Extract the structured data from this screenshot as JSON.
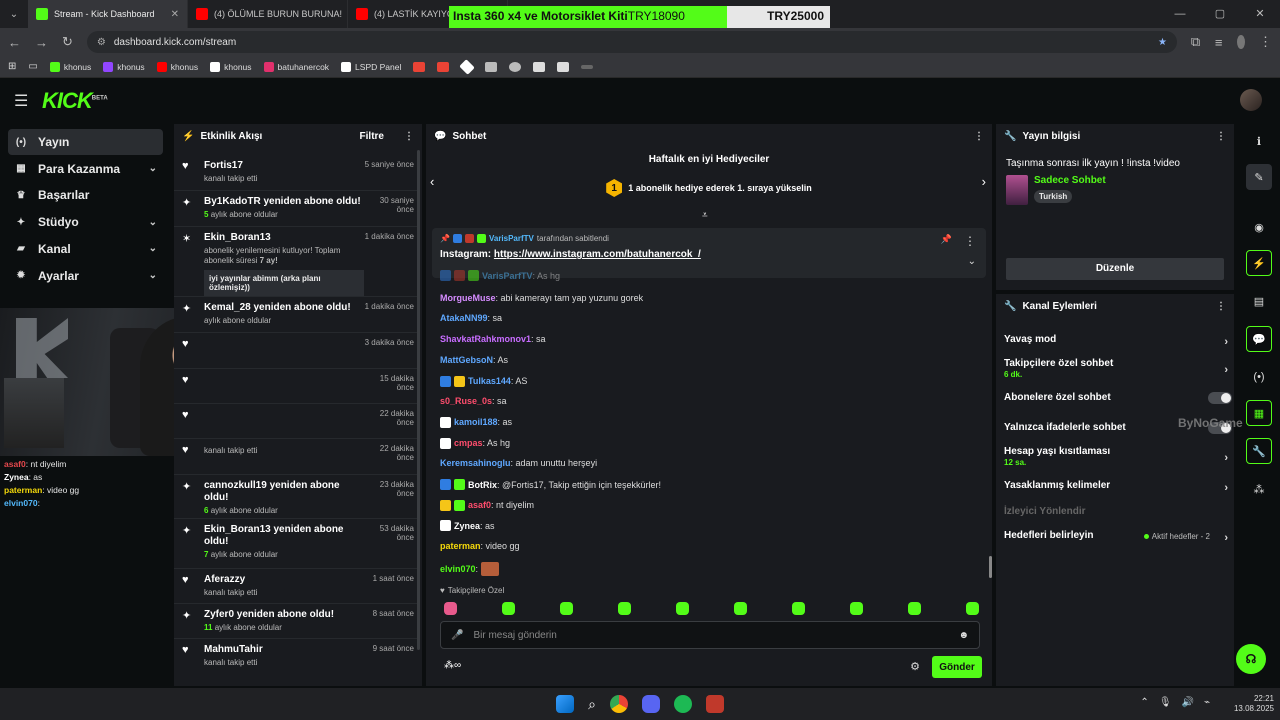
{
  "browser": {
    "tabs": [
      {
        "label": "Stream - Kick Dashboard",
        "active": true,
        "color": "#53fc18"
      },
      {
        "label": "(4) ÖLÜMLE BURUN BURUNA!",
        "active": false,
        "color": "#ff0000"
      },
      {
        "label": "(4) LASTİK KAYIYOR MU",
        "active": false,
        "color": "#ff0000"
      }
    ],
    "url": "dashboard.kick.com/stream",
    "bookmarks": [
      {
        "label": "khonus",
        "color": "#53fc18"
      },
      {
        "label": "khonus",
        "color": "#9146ff"
      },
      {
        "label": "khonus",
        "color": "#ff0000"
      },
      {
        "label": "khonus",
        "color": "#ffffff"
      },
      {
        "label": "batuhanercok",
        "color": "#e1306c"
      },
      {
        "label": "LSPD Panel",
        "color": "#ffffff"
      }
    ]
  },
  "donation": {
    "item": "Insta 360 x4 ve Motorsiklet Kiti",
    "current": "TRY18090",
    "goal": "TRY25000"
  },
  "header": {
    "logo": "KICK",
    "beta": "BETA"
  },
  "sidebar": {
    "items": [
      {
        "label": "Yayın",
        "icon": "broadcast-icon",
        "glyph": "(•)",
        "active": true,
        "chevron": false
      },
      {
        "label": "Para Kazanma",
        "icon": "money-icon",
        "glyph": "▦",
        "active": false,
        "chevron": true
      },
      {
        "label": "Başarılar",
        "icon": "trophy-icon",
        "glyph": "♛",
        "active": false,
        "chevron": false
      },
      {
        "label": "Stüdyo",
        "icon": "studio-icon",
        "glyph": "✦",
        "active": false,
        "chevron": true
      },
      {
        "label": "Kanal",
        "icon": "channel-icon",
        "glyph": "▰",
        "active": false,
        "chevron": true
      },
      {
        "label": "Ayarlar",
        "icon": "settings-icon",
        "glyph": "✹",
        "active": false,
        "chevron": true
      }
    ]
  },
  "overlay_chat": [
    {
      "user": "asaf0",
      "text": ": nt diyelim",
      "color": "#e5484d"
    },
    {
      "user": "Zynea",
      "text": ": as",
      "color": "#ffffff"
    },
    {
      "user": "paterman",
      "text": ": video gg",
      "color": "#f5d90a"
    },
    {
      "user": "elvin070",
      "text": ":",
      "color": "#53b9fc"
    }
  ],
  "activity": {
    "title": "Etkinlik Akışı",
    "filter": "Filtre",
    "items": [
      {
        "icon": "heart-icon",
        "glyph": "♥",
        "title": "Fortis17",
        "sub": "kanalı takip etti",
        "time": "5 saniye önce"
      },
      {
        "icon": "sparkle-icon",
        "glyph": "✦",
        "title": "By1KadoTR yeniden abone oldu!",
        "count": "5",
        "sub": "aylık abone oldular",
        "time": "30 saniye önce"
      },
      {
        "icon": "star-icon",
        "glyph": "✶",
        "title": "Ekin_Boran13",
        "sub": "abonelik yenilemesini kutluyor! Toplam abonelik süresi",
        "months": "7 ay!",
        "quote": "iyi yayınlar abimm (arka planı özlemişiz))",
        "time": "1 dakika önce"
      },
      {
        "icon": "sparkle-icon",
        "glyph": "✦",
        "title": "Kemal_28 yeniden abone oldu!",
        "sub": "aylık abone oldular",
        "time": "1 dakika önce"
      },
      {
        "icon": "heart-icon",
        "glyph": "♥",
        "title": "",
        "sub": "",
        "time": "3 dakika önce"
      },
      {
        "icon": "heart-icon",
        "glyph": "♥",
        "title": "",
        "sub": "",
        "time": "15 dakika önce"
      },
      {
        "icon": "heart-icon",
        "glyph": "♥",
        "title": "",
        "sub": "",
        "time": "22 dakika önce"
      },
      {
        "icon": "heart-icon",
        "glyph": "♥",
        "title": "",
        "sub": "kanalı takip etti",
        "time": "22 dakika önce"
      },
      {
        "icon": "sparkle-icon",
        "glyph": "✦",
        "title": "cannozkull19 yeniden abone oldu!",
        "count": "6",
        "sub": "aylık abone oldular",
        "time": "23 dakika önce"
      },
      {
        "icon": "sparkle-icon",
        "glyph": "✦",
        "title": "Ekin_Boran13 yeniden abone oldu!",
        "count": "7",
        "sub": "aylık abone oldular",
        "time": "53 dakika önce"
      },
      {
        "icon": "heart-icon",
        "glyph": "♥",
        "title": "Aferazzy",
        "sub": "kanalı takip etti",
        "time": "1 saat önce"
      },
      {
        "icon": "sparkle-icon",
        "glyph": "✦",
        "title": "Zyfer0 yeniden abone oldu!",
        "count": "11",
        "sub": "aylık abone oldular",
        "time": "8 saat önce"
      },
      {
        "icon": "heart-icon",
        "glyph": "♥",
        "title": "MahmuTahir",
        "sub": "kanalı takip etti",
        "time": "9 saat önce"
      }
    ]
  },
  "chat": {
    "title": "Sohbet",
    "gifters_title": "Haftalık en iyi Hediyeciler",
    "gifters_rank": "1",
    "gifters_text": "1 abonelik hediye ederek 1. sıraya yükselin",
    "pinned_by_user": "VarisParfTV",
    "pinned_by_suffix": "tarafından sabitlendi",
    "pinned_label": "Instagram:",
    "pinned_link": "https://www.instagram.com/batuhanercok_/",
    "messages": [
      {
        "user": "VarisParfTV",
        "text": ": As hg",
        "color": "#53b9fc",
        "badges": [
          "#2f7de1",
          "#c0392b",
          "#53fc18"
        ]
      },
      {
        "user": "MorgueMuse",
        "text": ": abi kamerayı tam yap yuzunu gorek",
        "color": "#d58cff",
        "badges": []
      },
      {
        "user": "AtakaNN99",
        "text": ": sa",
        "color": "#5fa8ff",
        "badges": []
      },
      {
        "user": "ShavkatRahkmonov1",
        "text": ": sa",
        "color": "#c86dff",
        "badges": []
      },
      {
        "user": "MattGebsoN",
        "text": ": As",
        "color": "#5fa8ff",
        "badges": []
      },
      {
        "user": "Tulkas144",
        "text": ": AS",
        "color": "#5fa8ff",
        "badges": [
          "#2f7de1",
          "#f5c518"
        ]
      },
      {
        "user": "s0_Ruse_0s",
        "text": ": sa",
        "color": "#ff4d6d",
        "badges": []
      },
      {
        "user": "kamoil188",
        "text": ": as",
        "color": "#5fa8ff",
        "badges": [
          "#ffffff"
        ]
      },
      {
        "user": "cmpas",
        "text": ": As hg",
        "color": "#ff4d6d",
        "badges": [
          "#ffffff"
        ]
      },
      {
        "user": "Keremsahinoglu",
        "text": ": adam unuttu herşeyi",
        "color": "#5fa8ff",
        "badges": []
      },
      {
        "user": "BotRix",
        "text": ": @Fortis17, Takip ettiğin için teşekkürler!",
        "color": "#ffffff",
        "badges": [
          "#2f7de1",
          "#53fc18"
        ]
      },
      {
        "user": "asaf0",
        "text": ": nt diyelim",
        "color": "#ff4d6d",
        "badges": [
          "#f5c518",
          "#53fc18"
        ]
      },
      {
        "user": "Zynea",
        "text": ": as",
        "color": "#ffffff",
        "badges": [
          "#ffffff"
        ]
      },
      {
        "user": "paterman",
        "text": ": video gg",
        "color": "#f5d90a",
        "badges": []
      },
      {
        "user": "elvin070",
        "text": ":",
        "color": "#53fc18",
        "badges": []
      }
    ],
    "followers_only_label": "Takipçilere Özel",
    "input_placeholder": "Bir mesaj gönderin",
    "send_label": "Gönder"
  },
  "stream_info": {
    "title": "Yayın bilgisi",
    "stream_title": "Taşınma sonrası ilk yayın ! !insta !video",
    "category": "Sadece Sohbet",
    "tag": "Turkish",
    "edit_label": "Düzenle"
  },
  "channel_actions": {
    "title": "Kanal Eylemleri",
    "items": [
      {
        "label": "Yavaş mod",
        "sub": "",
        "control": "arrow"
      },
      {
        "label": "Takipçilere özel sohbet",
        "sub": "6 dk.",
        "control": "arrow"
      },
      {
        "label": "Abonelere özel sohbet",
        "sub": "",
        "control": "toggle"
      },
      {
        "label": "Yalnızca ifadelerle sohbet",
        "sub": "",
        "control": "toggle"
      },
      {
        "label": "Hesap yaşı kısıtlaması",
        "sub": "12 sa.",
        "control": "arrow"
      },
      {
        "label": "Yasaklanmış kelimeler",
        "sub": "",
        "control": "arrow"
      },
      {
        "label": "İzleyici Yönlendir",
        "sub": "",
        "control": "none",
        "disabled": true
      },
      {
        "label": "Hedefleri belirleyin",
        "sub": "",
        "control": "arrow",
        "status": "Aktif hedefler - 2"
      }
    ],
    "watermark": "ByNoGame"
  },
  "taskbar": {
    "time": "22:21",
    "date": "13.08.2025"
  }
}
